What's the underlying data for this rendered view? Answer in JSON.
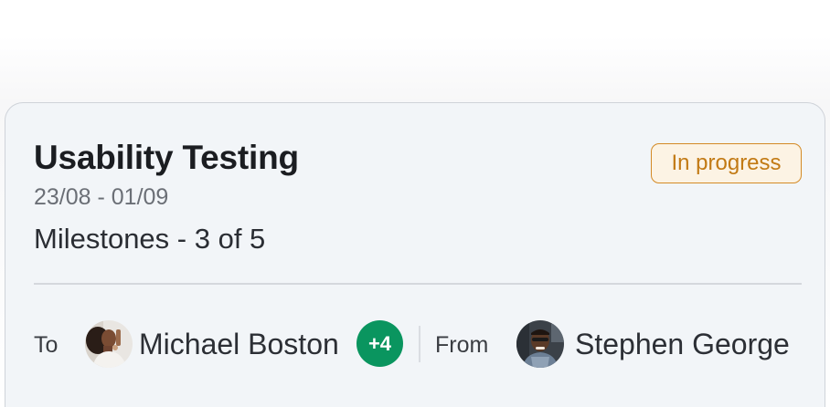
{
  "task": {
    "title": "Usability Testing",
    "dates": "23/08 - 01/09",
    "milestones": "Milestones - 3 of 5",
    "status": "In progress"
  },
  "assignment": {
    "to_label": "To",
    "to_name": "Michael Boston",
    "extra_assignees": "+4",
    "from_label": "From",
    "from_name": "Stephen George"
  },
  "colors": {
    "card_background": "#f2f5f8",
    "status_text": "#c27a14",
    "status_border": "#d48a25",
    "extra_badge": "#0a955f"
  }
}
